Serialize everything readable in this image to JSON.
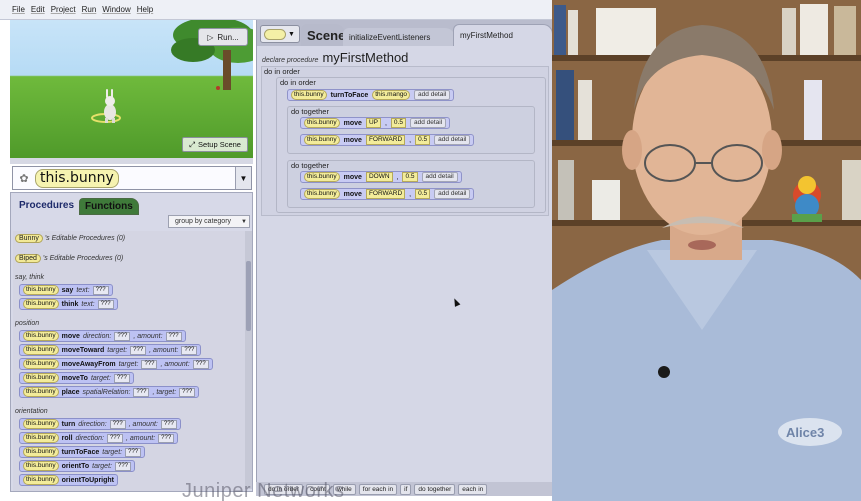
{
  "menubar": {
    "items": [
      "File",
      "Edit",
      "Project",
      "Run",
      "Window",
      "Help"
    ]
  },
  "scene_view": {
    "run_label": "Run...",
    "setup_label": "Setup Scene"
  },
  "object_selector": {
    "selected": "this.bunny"
  },
  "left_tabs": {
    "procedures": "Procedures",
    "functions": "Functions"
  },
  "group_by": "group by category",
  "editable": [
    {
      "type": "Bunny",
      "suffix": "'s Editable Procedures (0)"
    },
    {
      "type": "Biped",
      "suffix": "'s Editable Procedures (0)"
    }
  ],
  "categories": {
    "say_think": "say, think",
    "position": "position",
    "orientation": "orientation"
  },
  "procedures": [
    {
      "target": "this.bunny",
      "method": "say",
      "args": [
        "text:",
        "???"
      ]
    },
    {
      "target": "this.bunny",
      "method": "think",
      "args": [
        "text:",
        "???"
      ]
    },
    {
      "target": "this.bunny",
      "method": "move",
      "args": [
        "direction:",
        "???",
        ", amount:",
        "???"
      ]
    },
    {
      "target": "this.bunny",
      "method": "moveToward",
      "args": [
        "target:",
        "???",
        ", amount:",
        "???"
      ]
    },
    {
      "target": "this.bunny",
      "method": "moveAwayFrom",
      "args": [
        "target:",
        "???",
        ", amount:",
        "???"
      ]
    },
    {
      "target": "this.bunny",
      "method": "moveTo",
      "args": [
        "target:",
        "???"
      ]
    },
    {
      "target": "this.bunny",
      "method": "place",
      "args": [
        "spatialRelation:",
        "???",
        ", target:",
        "???"
      ]
    },
    {
      "target": "this.bunny",
      "method": "turn",
      "args": [
        "direction:",
        "???",
        ", amount:",
        "???"
      ]
    },
    {
      "target": "this.bunny",
      "method": "roll",
      "args": [
        "direction:",
        "???",
        ", amount:",
        "???"
      ]
    },
    {
      "target": "this.bunny",
      "method": "turnToFace",
      "args": [
        "target:",
        "???"
      ]
    },
    {
      "target": "this.bunny",
      "method": "orientTo",
      "args": [
        "target:",
        "???"
      ]
    },
    {
      "target": "this.bunny",
      "method": "orientToUpright",
      "args": []
    }
  ],
  "editor": {
    "scene_tab": "Scene",
    "init_tab": "initializeEventListeners",
    "method_tab": "myFirstMethod",
    "declare_kw": "declare procedure",
    "method_name": "myFirstMethod",
    "do_in_order": "do in order",
    "inner_do_in_order": "do in order",
    "do_together_1": "do together",
    "do_together_2": "do together",
    "add_detail": "add detail",
    "stmt_turn": {
      "target": "this.bunny",
      "method": "turnToFace",
      "arg": "this.mango"
    },
    "stmt_up": {
      "target": "this.bunny",
      "method": "move",
      "dir": "UP",
      "amt": "0.5"
    },
    "stmt_fwd1": {
      "target": "this.bunny",
      "method": "move",
      "dir": "FORWARD",
      "amt": "0.5"
    },
    "stmt_down": {
      "target": "this.bunny",
      "method": "move",
      "dir": "DOWN",
      "amt": "0.5"
    },
    "stmt_fwd2": {
      "target": "this.bunny",
      "method": "move",
      "dir": "FORWARD",
      "amt": "0.5"
    }
  },
  "control_bar": [
    "do in order",
    "count",
    "while",
    "for each in",
    "if",
    "do together",
    "each in"
  ],
  "watermark": "Juniper Networks",
  "webcam": {
    "shirt_logo": "Alice3"
  }
}
